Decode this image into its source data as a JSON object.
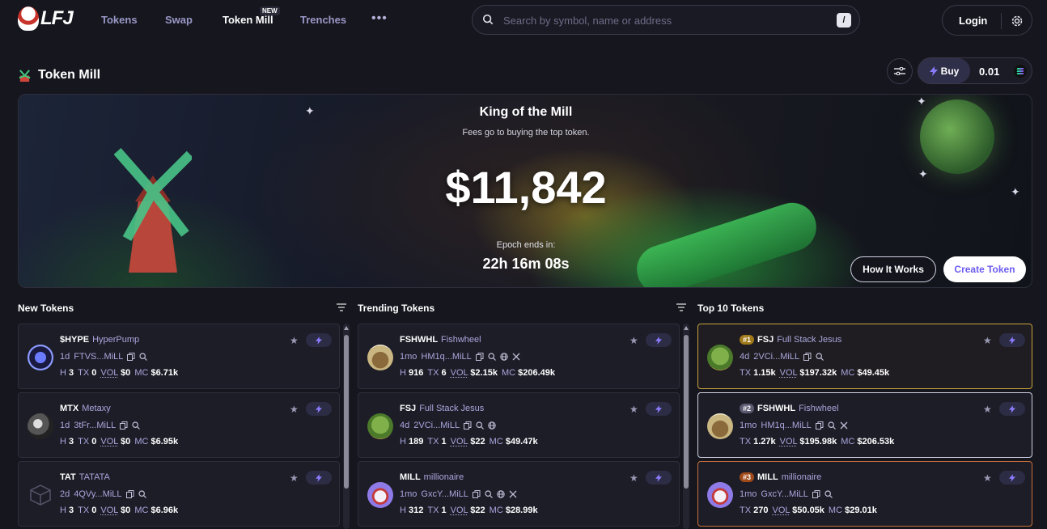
{
  "nav": {
    "logo": "LFJ",
    "links": [
      "Tokens",
      "Swap",
      "Token Mill",
      "Trenches"
    ],
    "new_badge": "NEW",
    "more": "•••",
    "search_placeholder": "Search by symbol, name or address",
    "search_shortcut": "/",
    "login": "Login"
  },
  "page": {
    "title": "Token Mill",
    "buy_label": "Buy",
    "buy_amount": "0.01"
  },
  "hero": {
    "title": "King of the Mill",
    "subtitle": "Fees go to buying the top token.",
    "amount": "$11,842",
    "epoch_label": "Epoch ends in:",
    "epoch_value": "22h 16m 08s",
    "how_it_works": "How It Works",
    "create_token": "Create Token"
  },
  "columns": {
    "new": {
      "title": "New Tokens",
      "items": [
        {
          "symbol": "$HYPE",
          "name": "HyperPump",
          "age": "1d",
          "address": "FTVS...MiLL",
          "h_label": "H",
          "h": "3",
          "tx_label": "TX",
          "tx": "0",
          "vol_label": "VOL",
          "vol": "$0",
          "mc_label": "MC",
          "mc": "$6.71k"
        },
        {
          "symbol": "MTX",
          "name": "Metaxy",
          "age": "1d",
          "address": "3tFr...MiLL",
          "h_label": "H",
          "h": "3",
          "tx_label": "TX",
          "tx": "0",
          "vol_label": "VOL",
          "vol": "$0",
          "mc_label": "MC",
          "mc": "$6.95k"
        },
        {
          "symbol": "TAT",
          "name": "TATATA",
          "age": "2d",
          "address": "4QVy...MiLL",
          "h_label": "H",
          "h": "3",
          "tx_label": "TX",
          "tx": "0",
          "vol_label": "VOL",
          "vol": "$0",
          "mc_label": "MC",
          "mc": "$6.96k"
        }
      ]
    },
    "trending": {
      "title": "Trending Tokens",
      "items": [
        {
          "symbol": "FSHWHL",
          "name": "Fishwheel",
          "age": "1mo",
          "address": "HM1q...MiLL",
          "h_label": "H",
          "h": "916",
          "tx_label": "TX",
          "tx": "6",
          "vol_label": "VOL",
          "vol": "$2.15k",
          "mc_label": "MC",
          "mc": "$206.49k"
        },
        {
          "symbol": "FSJ",
          "name": "Full Stack Jesus",
          "age": "4d",
          "address": "2VCi...MiLL",
          "h_label": "H",
          "h": "189",
          "tx_label": "TX",
          "tx": "1",
          "vol_label": "VOL",
          "vol": "$22",
          "mc_label": "MC",
          "mc": "$49.47k"
        },
        {
          "symbol": "MILL",
          "name": "millionaire",
          "age": "1mo",
          "address": "GxcY...MiLL",
          "h_label": "H",
          "h": "312",
          "tx_label": "TX",
          "tx": "1",
          "vol_label": "VOL",
          "vol": "$22",
          "mc_label": "MC",
          "mc": "$28.99k"
        }
      ]
    },
    "top10": {
      "title": "Top 10 Tokens",
      "items": [
        {
          "rank": "#1",
          "symbol": "FSJ",
          "name": "Full Stack Jesus",
          "age": "4d",
          "address": "2VCi...MiLL",
          "tx_label": "TX",
          "tx": "1.15k",
          "vol_label": "VOL",
          "vol": "$197.32k",
          "mc_label": "MC",
          "mc": "$49.45k"
        },
        {
          "rank": "#2",
          "symbol": "FSHWHL",
          "name": "Fishwheel",
          "age": "1mo",
          "address": "HM1q...MiLL",
          "tx_label": "TX",
          "tx": "1.27k",
          "vol_label": "VOL",
          "vol": "$195.98k",
          "mc_label": "MC",
          "mc": "$206.53k"
        },
        {
          "rank": "#3",
          "symbol": "MILL",
          "name": "millionaire",
          "age": "1mo",
          "address": "GxcY...MiLL",
          "tx_label": "TX",
          "tx": "270",
          "vol_label": "VOL",
          "vol": "$50.05k",
          "mc_label": "MC",
          "mc": "$29.01k"
        }
      ]
    }
  },
  "colors": {
    "accent": "#6b5cf0",
    "rank1": "#c7a23a",
    "rank2": "#cfd0e0",
    "rank3": "#c7703a"
  }
}
